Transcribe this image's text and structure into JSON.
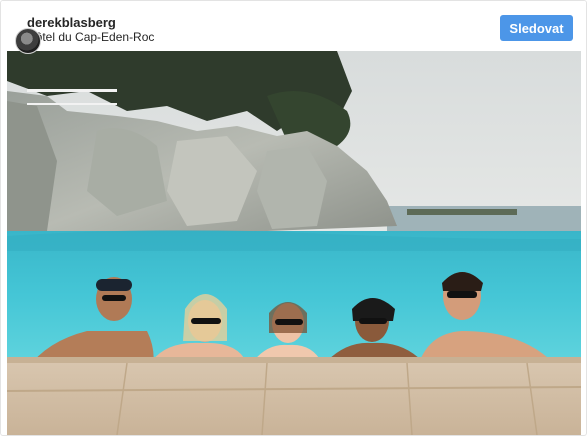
{
  "post": {
    "username": "derekblasberg",
    "location": "Hôtel du Cap-Eden-Roc",
    "follow_label": "Sledovat"
  },
  "colors": {
    "follow_button": "#4c96e8",
    "pool_water": "#3bbfd0",
    "sky": "#dfe3e4"
  },
  "icons": {
    "avatar": "profile-avatar"
  },
  "photo": {
    "subject_count": 5
  }
}
